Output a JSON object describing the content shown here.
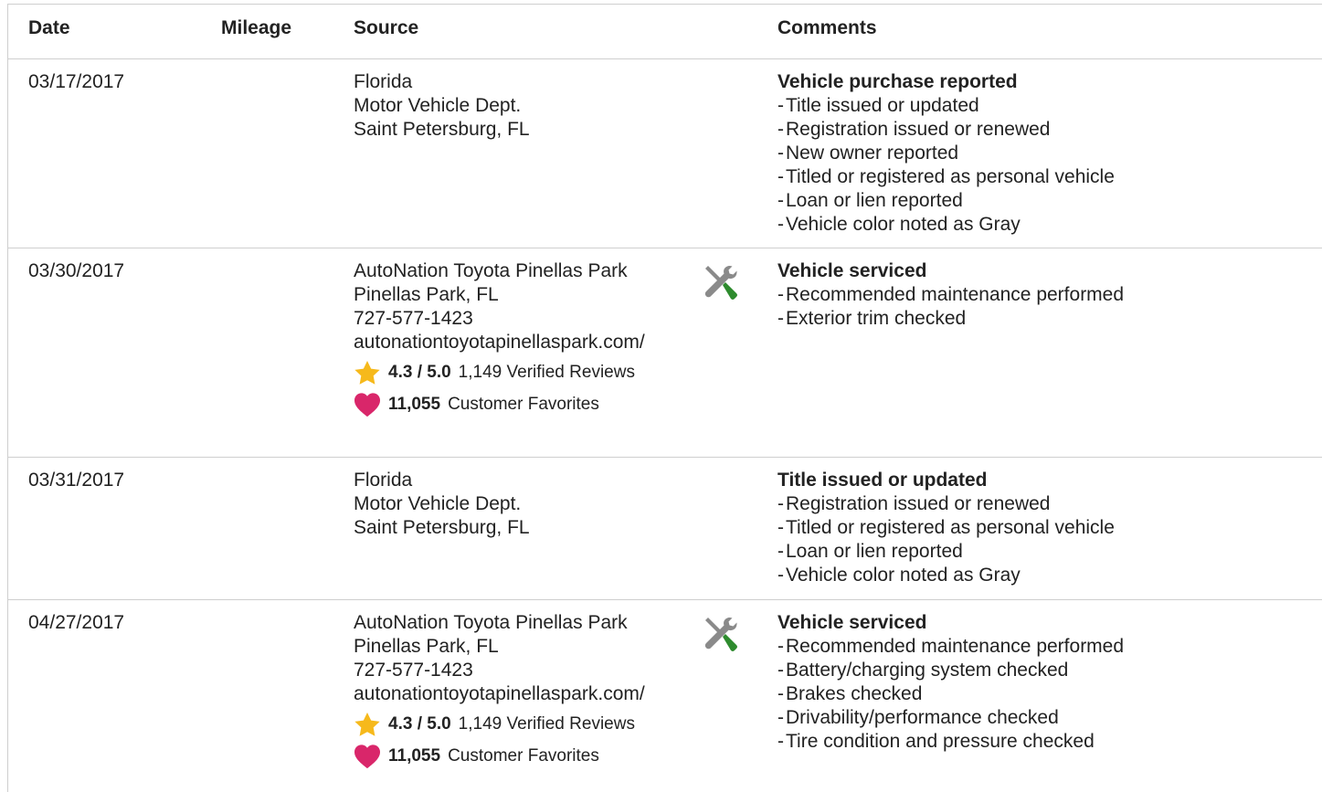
{
  "headers": {
    "date": "Date",
    "mileage": "Mileage",
    "source": "Source",
    "comments": "Comments"
  },
  "colors": {
    "star": "#f6b91b",
    "heart": "#d9266a",
    "tool_gray": "#8a8a8a",
    "tool_green": "#2e8b2e",
    "border": "#cfcfcf"
  },
  "rows": [
    {
      "date": "03/17/2017",
      "mileage": "",
      "source": {
        "lines": [
          "Florida",
          "Motor Vehicle Dept.",
          "Saint Petersburg, FL"
        ]
      },
      "icon": "",
      "comments": {
        "title": "Vehicle purchase reported",
        "items": [
          "Title issued or updated",
          "Registration issued or renewed",
          "New owner reported",
          "Titled or registered as personal vehicle",
          "Loan or lien reported",
          "Vehicle color noted as Gray"
        ]
      }
    },
    {
      "date": "03/30/2017",
      "mileage": "",
      "source": {
        "lines": [
          "AutoNation Toyota Pinellas Park",
          "Pinellas Park, FL",
          "727-577-1423"
        ],
        "url": "autonationtoyotapinellaspark.com/",
        "rating": "4.3 / 5.0",
        "reviews": "1,149 Verified Reviews",
        "favorites_count": "11,055",
        "favorites_label": "Customer Favorites"
      },
      "icon": "service-tools-icon",
      "comments": {
        "title": "Vehicle serviced",
        "items": [
          "Recommended maintenance performed",
          "Exterior trim checked"
        ]
      }
    },
    {
      "date": "03/31/2017",
      "mileage": "",
      "source": {
        "lines": [
          "Florida",
          "Motor Vehicle Dept.",
          "Saint Petersburg, FL"
        ]
      },
      "icon": "",
      "comments": {
        "title": "Title issued or updated",
        "items": [
          "Registration issued or renewed",
          "Titled or registered as personal vehicle",
          "Loan or lien reported",
          "Vehicle color noted as Gray"
        ]
      }
    },
    {
      "date": "04/27/2017",
      "mileage": "",
      "source": {
        "lines": [
          "AutoNation Toyota Pinellas Park",
          "Pinellas Park, FL",
          "727-577-1423"
        ],
        "url": "autonationtoyotapinellaspark.com/",
        "rating": "4.3 / 5.0",
        "reviews": "1,149 Verified Reviews",
        "favorites_count": "11,055",
        "favorites_label": "Customer Favorites"
      },
      "icon": "service-tools-icon",
      "comments": {
        "title": "Vehicle serviced",
        "items": [
          "Recommended maintenance performed",
          "Battery/charging system checked",
          "Brakes checked",
          "Drivability/performance checked",
          "Tire condition and pressure checked"
        ]
      }
    }
  ]
}
